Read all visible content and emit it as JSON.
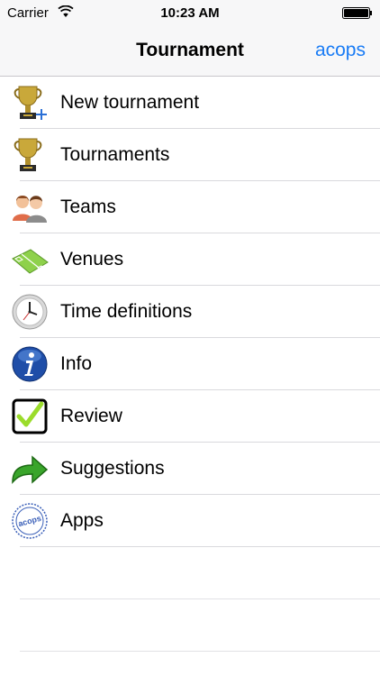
{
  "status_bar": {
    "carrier": "Carrier",
    "time": "10:23 AM",
    "wifi_icon": "wifi-icon",
    "battery_icon": "battery-icon"
  },
  "navbar": {
    "title": "Tournament",
    "right_button_label": "acops",
    "accent_color": "#1a7cf5"
  },
  "menu": {
    "items": [
      {
        "label": "New tournament",
        "icon": "trophy-plus-icon"
      },
      {
        "label": "Tournaments",
        "icon": "trophy-icon"
      },
      {
        "label": "Teams",
        "icon": "people-icon"
      },
      {
        "label": "Venues",
        "icon": "field-icon"
      },
      {
        "label": "Time definitions",
        "icon": "clock-icon"
      },
      {
        "label": "Info",
        "icon": "info-icon"
      },
      {
        "label": "Review",
        "icon": "checkbox-icon"
      },
      {
        "label": "Suggestions",
        "icon": "arrow-icon"
      },
      {
        "label": "Apps",
        "icon": "acops-stamp-icon"
      }
    ]
  },
  "stamp_text": "acops"
}
